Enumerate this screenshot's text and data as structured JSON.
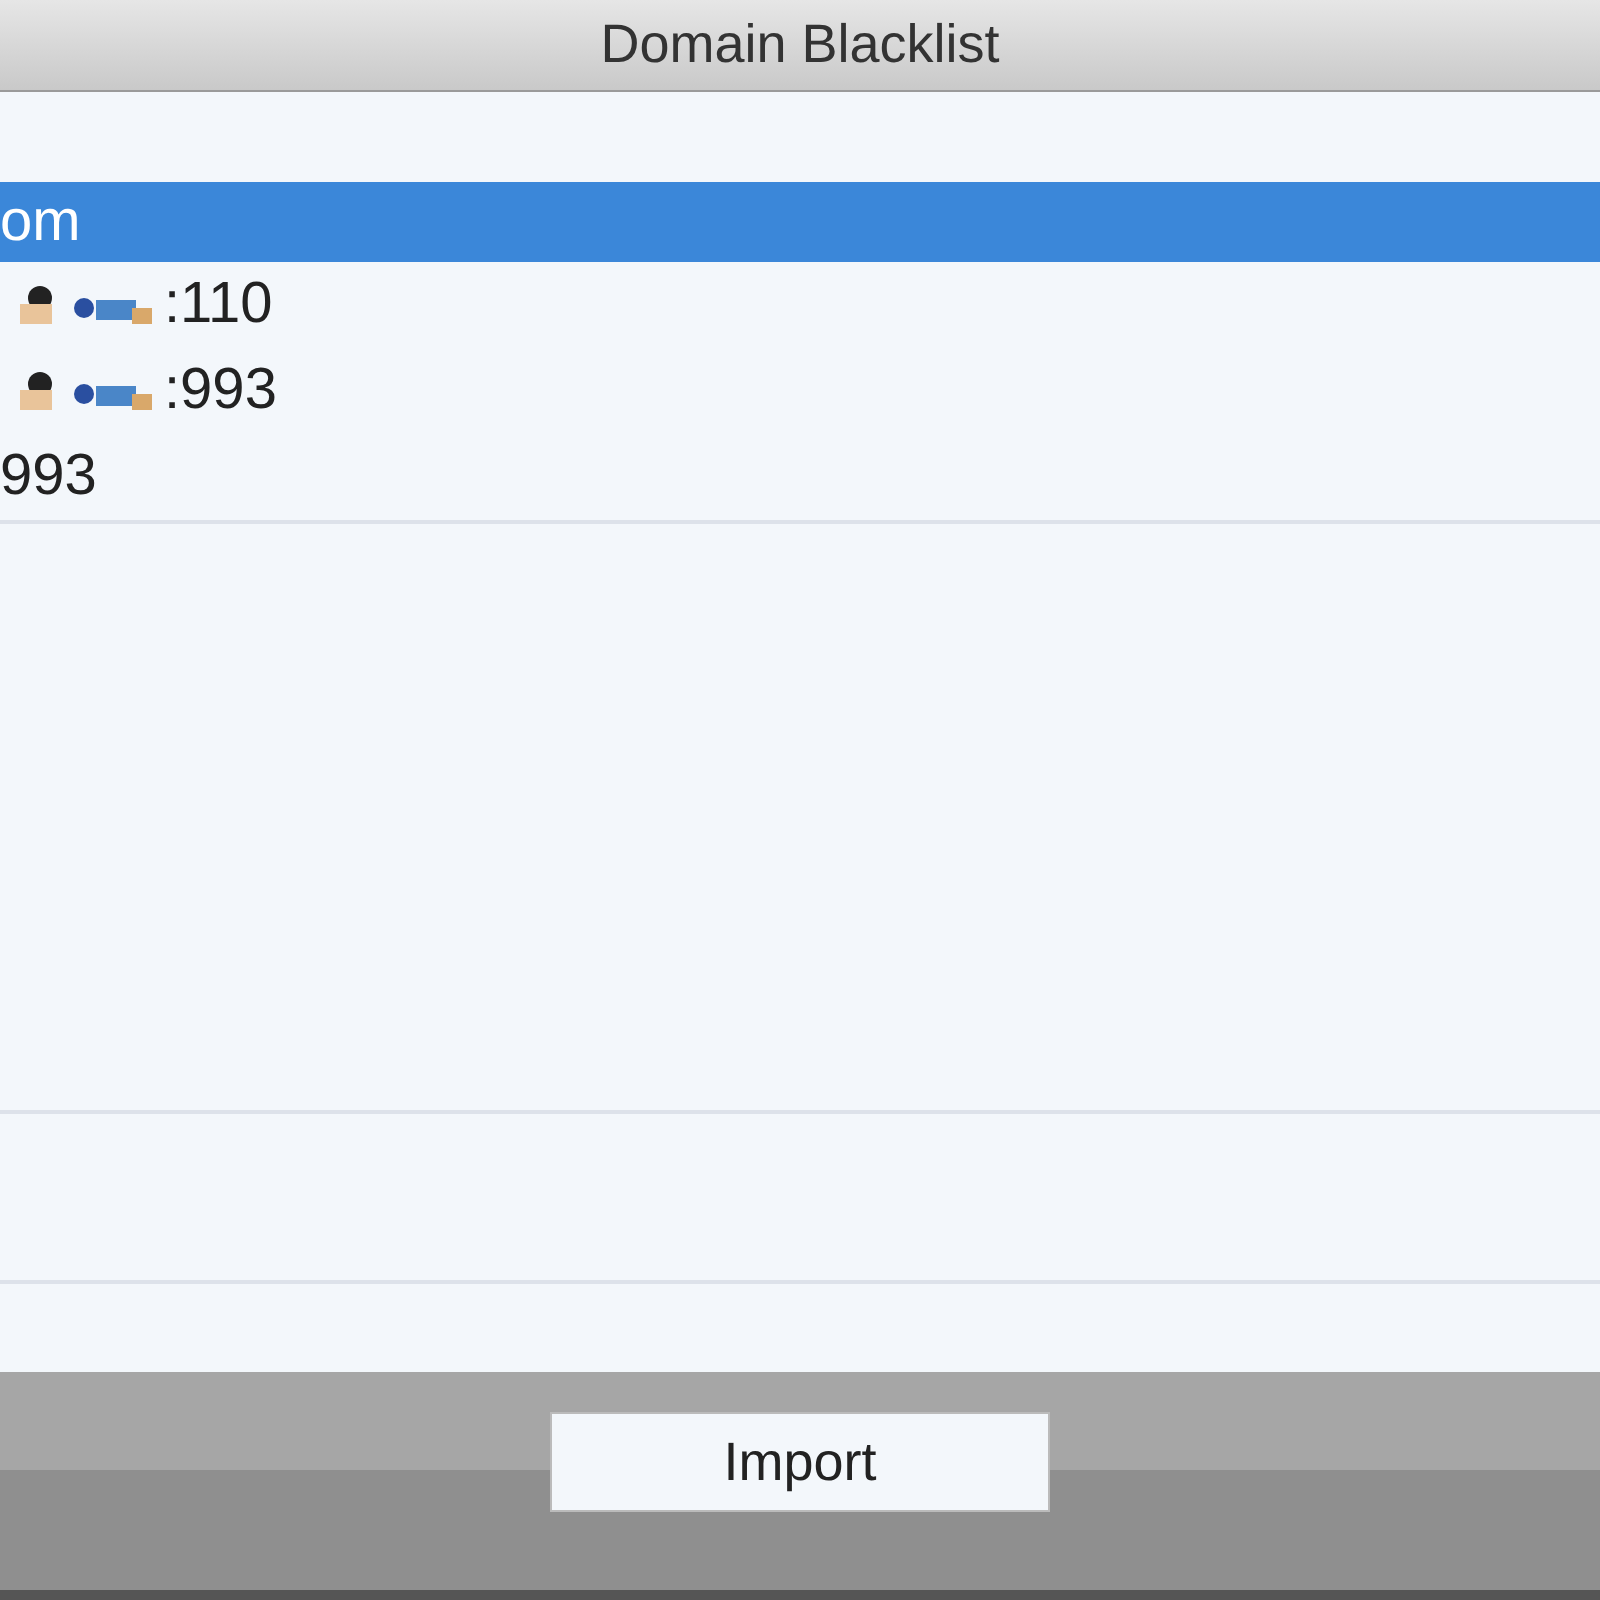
{
  "window": {
    "title": "Domain Blacklist"
  },
  "list": {
    "rows": [
      {
        "text": "om",
        "selected": true,
        "redacted": false
      },
      {
        "text": ":110",
        "selected": false,
        "redacted": true
      },
      {
        "text": ":993",
        "selected": false,
        "redacted": true
      },
      {
        "text": "993",
        "selected": false,
        "redacted": false
      }
    ]
  },
  "buttons": [
    {
      "label": "Import"
    }
  ]
}
